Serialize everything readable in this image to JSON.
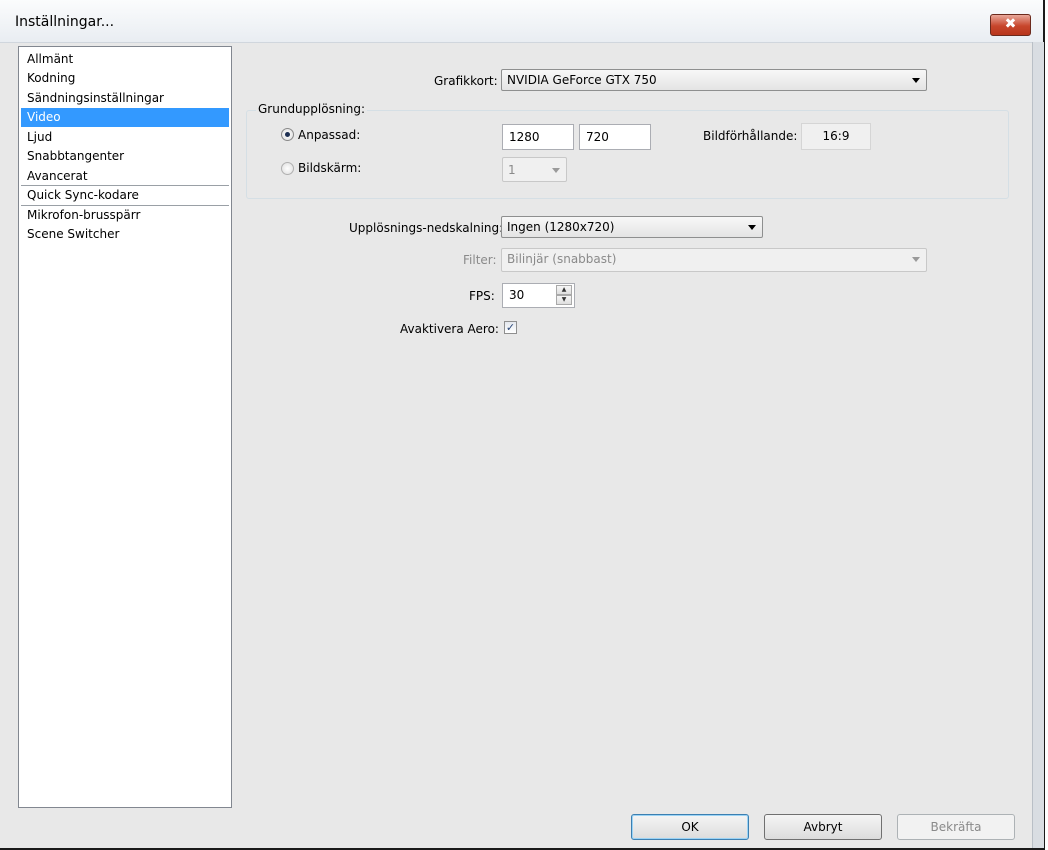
{
  "window": {
    "title": "Inställningar...",
    "close_symbol": "✖"
  },
  "sidebar": {
    "items": [
      {
        "label": "Allmänt"
      },
      {
        "label": "Kodning"
      },
      {
        "label": "Sändningsinställningar"
      },
      {
        "label": "Video",
        "selected": true
      },
      {
        "label": "Ljud"
      },
      {
        "label": "Snabbtangenter"
      },
      {
        "label": "Avancerat"
      },
      {
        "label": "Quick Sync-kodare"
      },
      {
        "label": "Mikrofon-brusspärr"
      },
      {
        "label": "Scene Switcher"
      }
    ]
  },
  "video": {
    "graphics_card": {
      "label": "Grafikkort:",
      "value": "NVIDIA GeForce GTX 750"
    },
    "base_resolution": {
      "group_title": "Grundupplösning:",
      "custom": {
        "label": "Anpassad:",
        "selected": true,
        "width": "1280",
        "height": "720"
      },
      "aspect": {
        "label": "Bildförhållande:",
        "value": "16:9"
      },
      "monitor": {
        "label": "Bildskärm:",
        "selected": false,
        "value": "1"
      }
    },
    "downscale": {
      "label": "Upplösnings-nedskalning:",
      "value": "Ingen  (1280x720)"
    },
    "filter": {
      "label": "Filter:",
      "value": "Bilinjär (snabbast)",
      "enabled": false
    },
    "fps": {
      "label": "FPS:",
      "value": "30",
      "up_symbol": "▲",
      "down_symbol": "▼"
    },
    "disable_aero": {
      "label": "Avaktivera Aero:",
      "checked": true,
      "check_symbol": "✓"
    }
  },
  "buttons": {
    "ok": "OK",
    "cancel": "Avbryt",
    "apply": "Bekräfta"
  },
  "colors": {
    "selection": "#3399ff",
    "close_button": "#c7462c"
  }
}
